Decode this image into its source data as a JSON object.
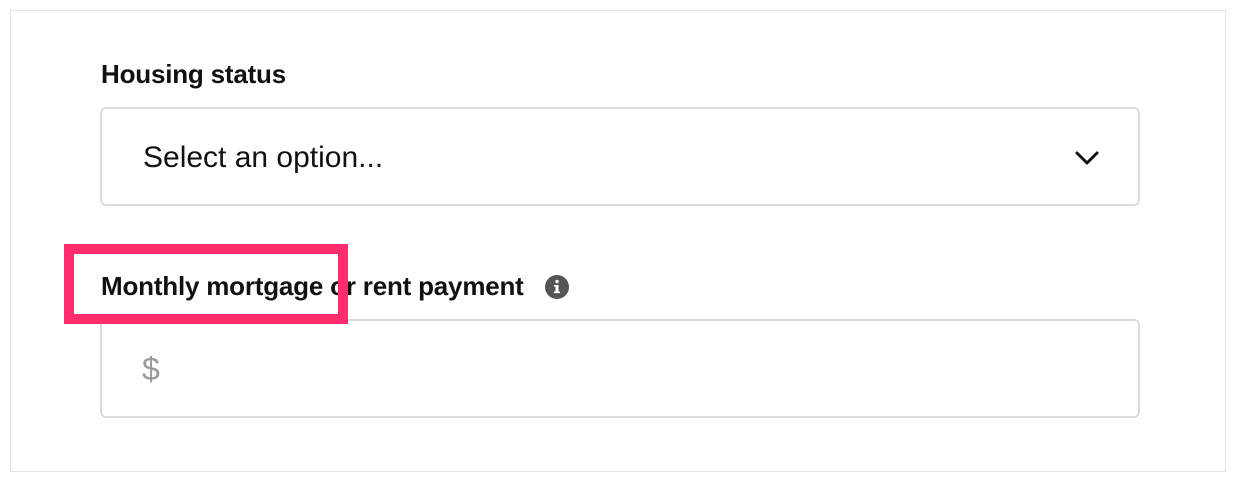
{
  "form": {
    "housing_status": {
      "label": "Housing status",
      "selected_value": "Select an option...",
      "icon": "chevron-down-icon"
    },
    "monthly_payment": {
      "label": "Monthly mortgage or rent payment",
      "prefix": "$",
      "value": "",
      "info_icon": "info-icon"
    }
  },
  "annotation": {
    "highlight_color": "#ff2d6e"
  }
}
